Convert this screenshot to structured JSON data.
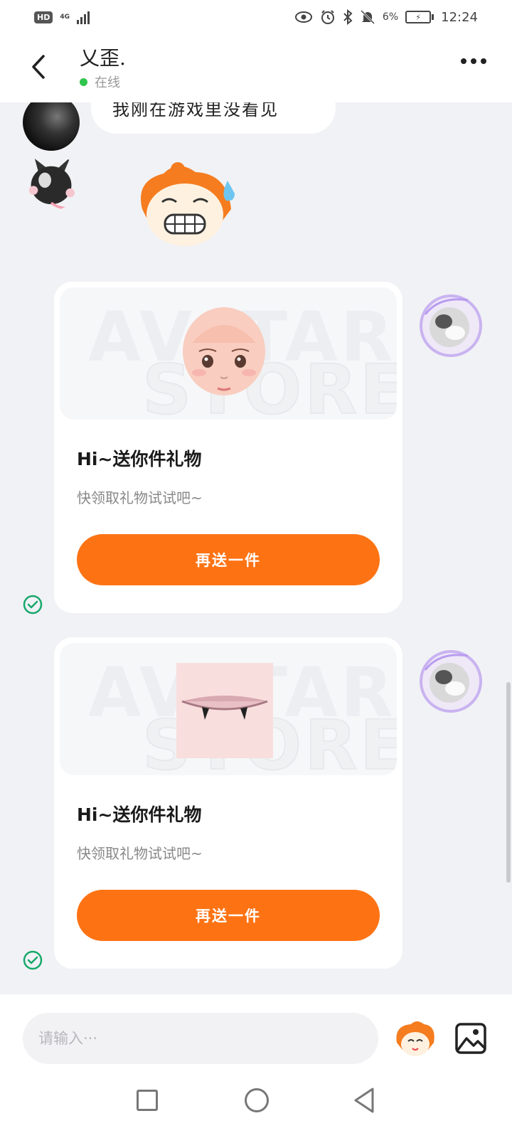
{
  "status_bar": {
    "hd": "HD",
    "network": "4G",
    "battery_percent": "6%",
    "time": "12:24"
  },
  "header": {
    "contact_name": "乂歪.",
    "status": "在线"
  },
  "messages": {
    "text_message": "我刚在游戏里没看见"
  },
  "gift_cards": [
    {
      "watermark_line1": "AVATAR",
      "watermark_line2": "STORE",
      "title": "Hi~送你件礼物",
      "subtitle": "快领取礼物试试吧~",
      "button_label": "再送一件"
    },
    {
      "watermark_line1": "AVATAR",
      "watermark_line2": "STORE",
      "title": "Hi~送你件礼物",
      "subtitle": "快领取礼物试试吧~",
      "button_label": "再送一件"
    }
  ],
  "input": {
    "placeholder": "请输入···"
  },
  "colors": {
    "accent": "#fd7314",
    "online": "#2fc54c",
    "read_check": "#17a86b"
  },
  "icons": [
    "back-arrow-icon",
    "more-icon",
    "read-check-icon",
    "emoji-sticker-icon",
    "image-icon",
    "nav-recent-icon",
    "nav-home-icon",
    "nav-back-icon"
  ]
}
